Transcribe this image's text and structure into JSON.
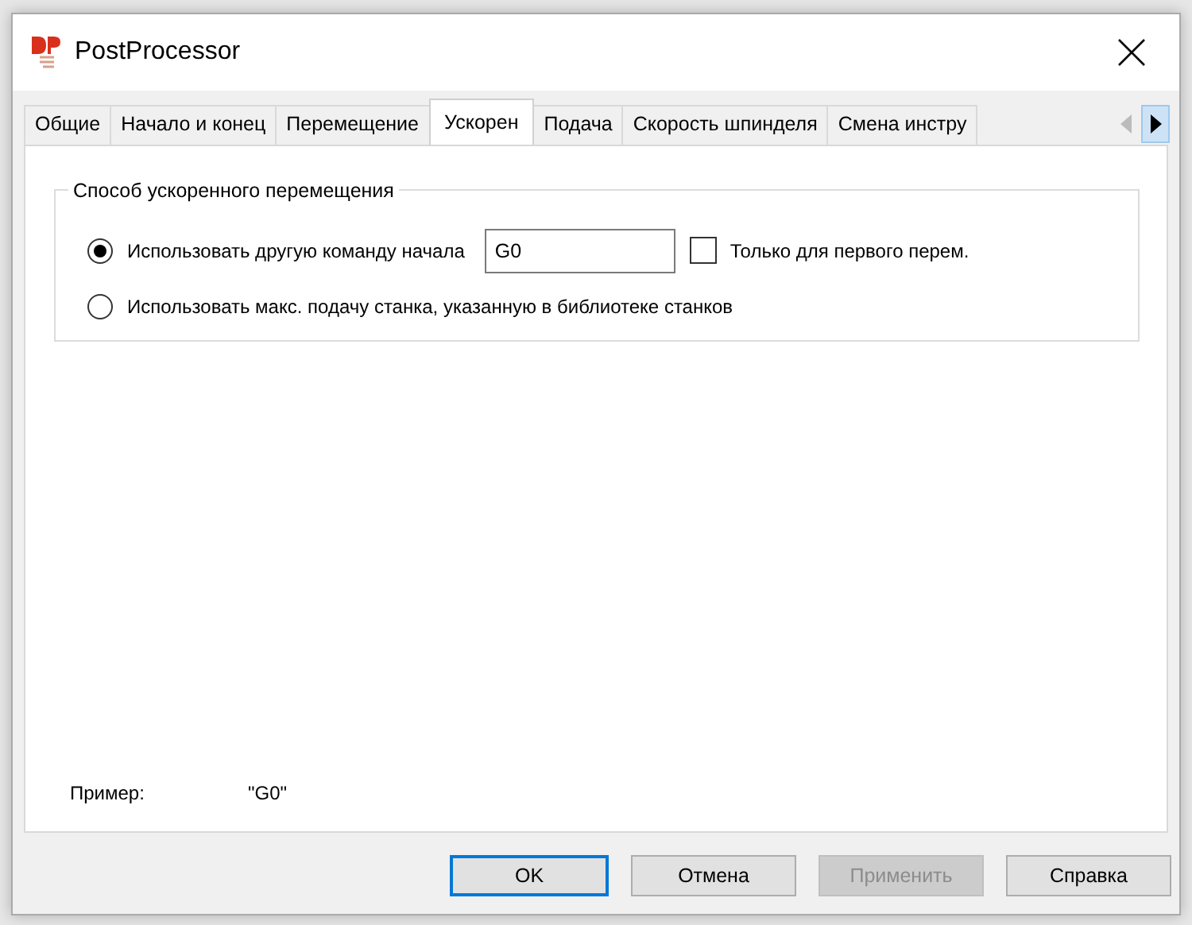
{
  "window": {
    "title": "PostProcessor"
  },
  "tabs": [
    {
      "label": "Общие",
      "selected": false
    },
    {
      "label": "Начало и конец",
      "selected": false
    },
    {
      "label": "Перемещение",
      "selected": false
    },
    {
      "label": "Ускорен",
      "selected": true
    },
    {
      "label": "Подача",
      "selected": false
    },
    {
      "label": "Скорость шпинделя",
      "selected": false
    },
    {
      "label": "Смена инстру",
      "selected": false
    }
  ],
  "group": {
    "title": "Способ ускоренного перемещения",
    "options": [
      {
        "label": "Использовать другую команду начала",
        "selected": true,
        "field_value": "G0",
        "checkbox": {
          "label": "Только для первого перем.",
          "checked": false
        }
      },
      {
        "label": "Использовать макс. подачу станка, указанную в библиотеке станков",
        "selected": false
      }
    ]
  },
  "example": {
    "label": "Пример:",
    "value": "\"G0\""
  },
  "buttons": [
    {
      "label": "OK",
      "default": true,
      "disabled": false
    },
    {
      "label": "Отмена",
      "default": false,
      "disabled": false
    },
    {
      "label": "Применить",
      "default": false,
      "disabled": true
    },
    {
      "label": "Справка",
      "default": false,
      "disabled": false
    }
  ]
}
